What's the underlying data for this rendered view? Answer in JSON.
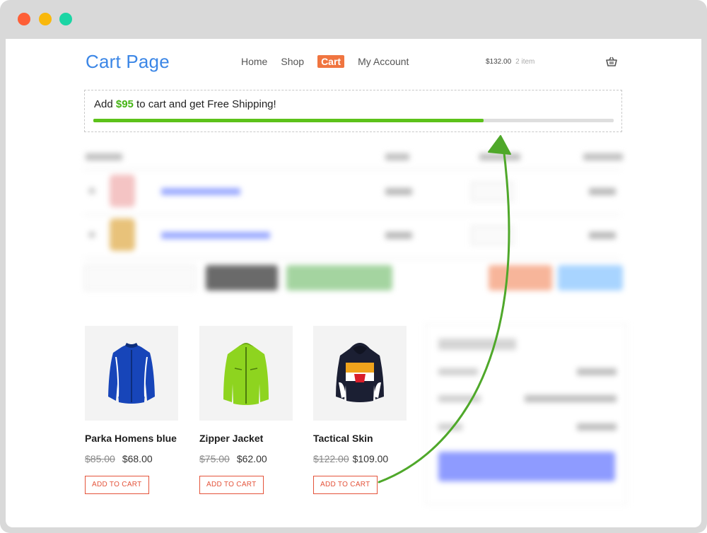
{
  "window": {
    "buttons": [
      "close",
      "minimize",
      "maximize"
    ]
  },
  "header": {
    "site_title": "Cart Page",
    "nav": [
      "Home",
      "Shop",
      "Cart",
      "My Account"
    ],
    "active_nav": "Cart",
    "cart_total": "$132.00",
    "cart_count": "2 item",
    "cart_icon": "basket-icon"
  },
  "shipping": {
    "text_before": "Add ",
    "amount": "$95",
    "text_after": " to cart and get Free Shipping!",
    "progress_percent": 75
  },
  "products": [
    {
      "name": "Parka Homens blue",
      "old_price": "$85.00",
      "price": "$68.00",
      "button": "ADD TO CART"
    },
    {
      "name": "Zipper Jacket",
      "old_price": "$75.00",
      "price": "$62.00",
      "button": "ADD TO CART"
    },
    {
      "name": "Tactical Skin",
      "old_price": "$122.00",
      "price": "$109.00",
      "button": "ADD TO CART"
    }
  ],
  "colors": {
    "accent": "#3b86e6",
    "progress": "#5cc21a",
    "cart_tab": "#f07540",
    "add_button": "#e4533a",
    "arrow": "#4fa82a"
  }
}
